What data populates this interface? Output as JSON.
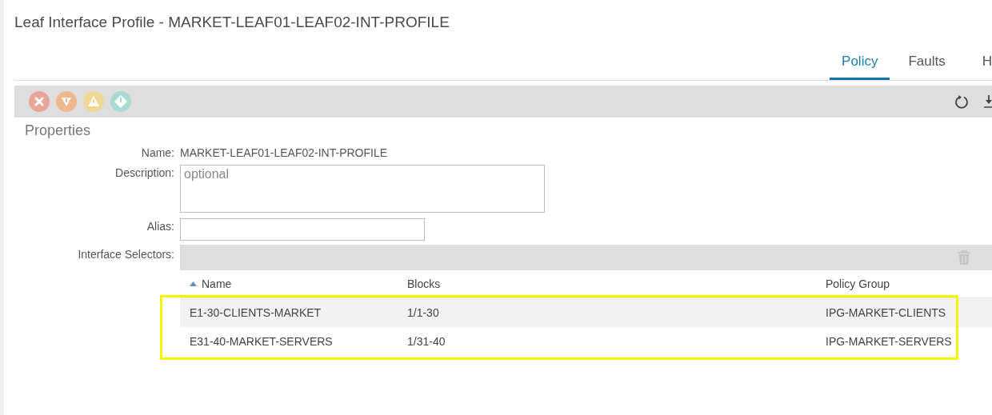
{
  "window": {
    "title": "Leaf Interface Profile - MARKET-LEAF01-LEAF02-INT-PROFILE"
  },
  "tabs": [
    {
      "label": "Policy",
      "selected": true
    },
    {
      "label": "Faults",
      "selected": false
    },
    {
      "label": "H",
      "selected": false
    }
  ],
  "fault_counts": [
    {
      "kind": "critical",
      "color": "#eaa59b"
    },
    {
      "kind": "major",
      "color": "#f0b88f"
    },
    {
      "kind": "minor",
      "color": "#f1d892"
    },
    {
      "kind": "warning",
      "color": "#a9d9d0"
    }
  ],
  "section": "Properties",
  "fields": [
    {
      "label": "Name:",
      "kind": "text",
      "value": "MARKET-LEAF01-LEAF02-INT-PROFILE"
    },
    {
      "label": "Description:",
      "kind": "textarea",
      "placeholder": "optional"
    },
    {
      "label": "Alias:",
      "kind": "input"
    }
  ],
  "selectors": {
    "label": "Interface Selectors:",
    "columns": [
      "Name",
      "Blocks",
      "Policy Group"
    ],
    "rows": [
      [
        "E1-30-CLIENTS-MARKET",
        "1/1-30",
        "IPG-MARKET-CLIENTS"
      ],
      [
        "E31-40-MARKET-SERVERS",
        "1/31-40",
        "IPG-MARKET-SERVERS"
      ]
    ]
  }
}
